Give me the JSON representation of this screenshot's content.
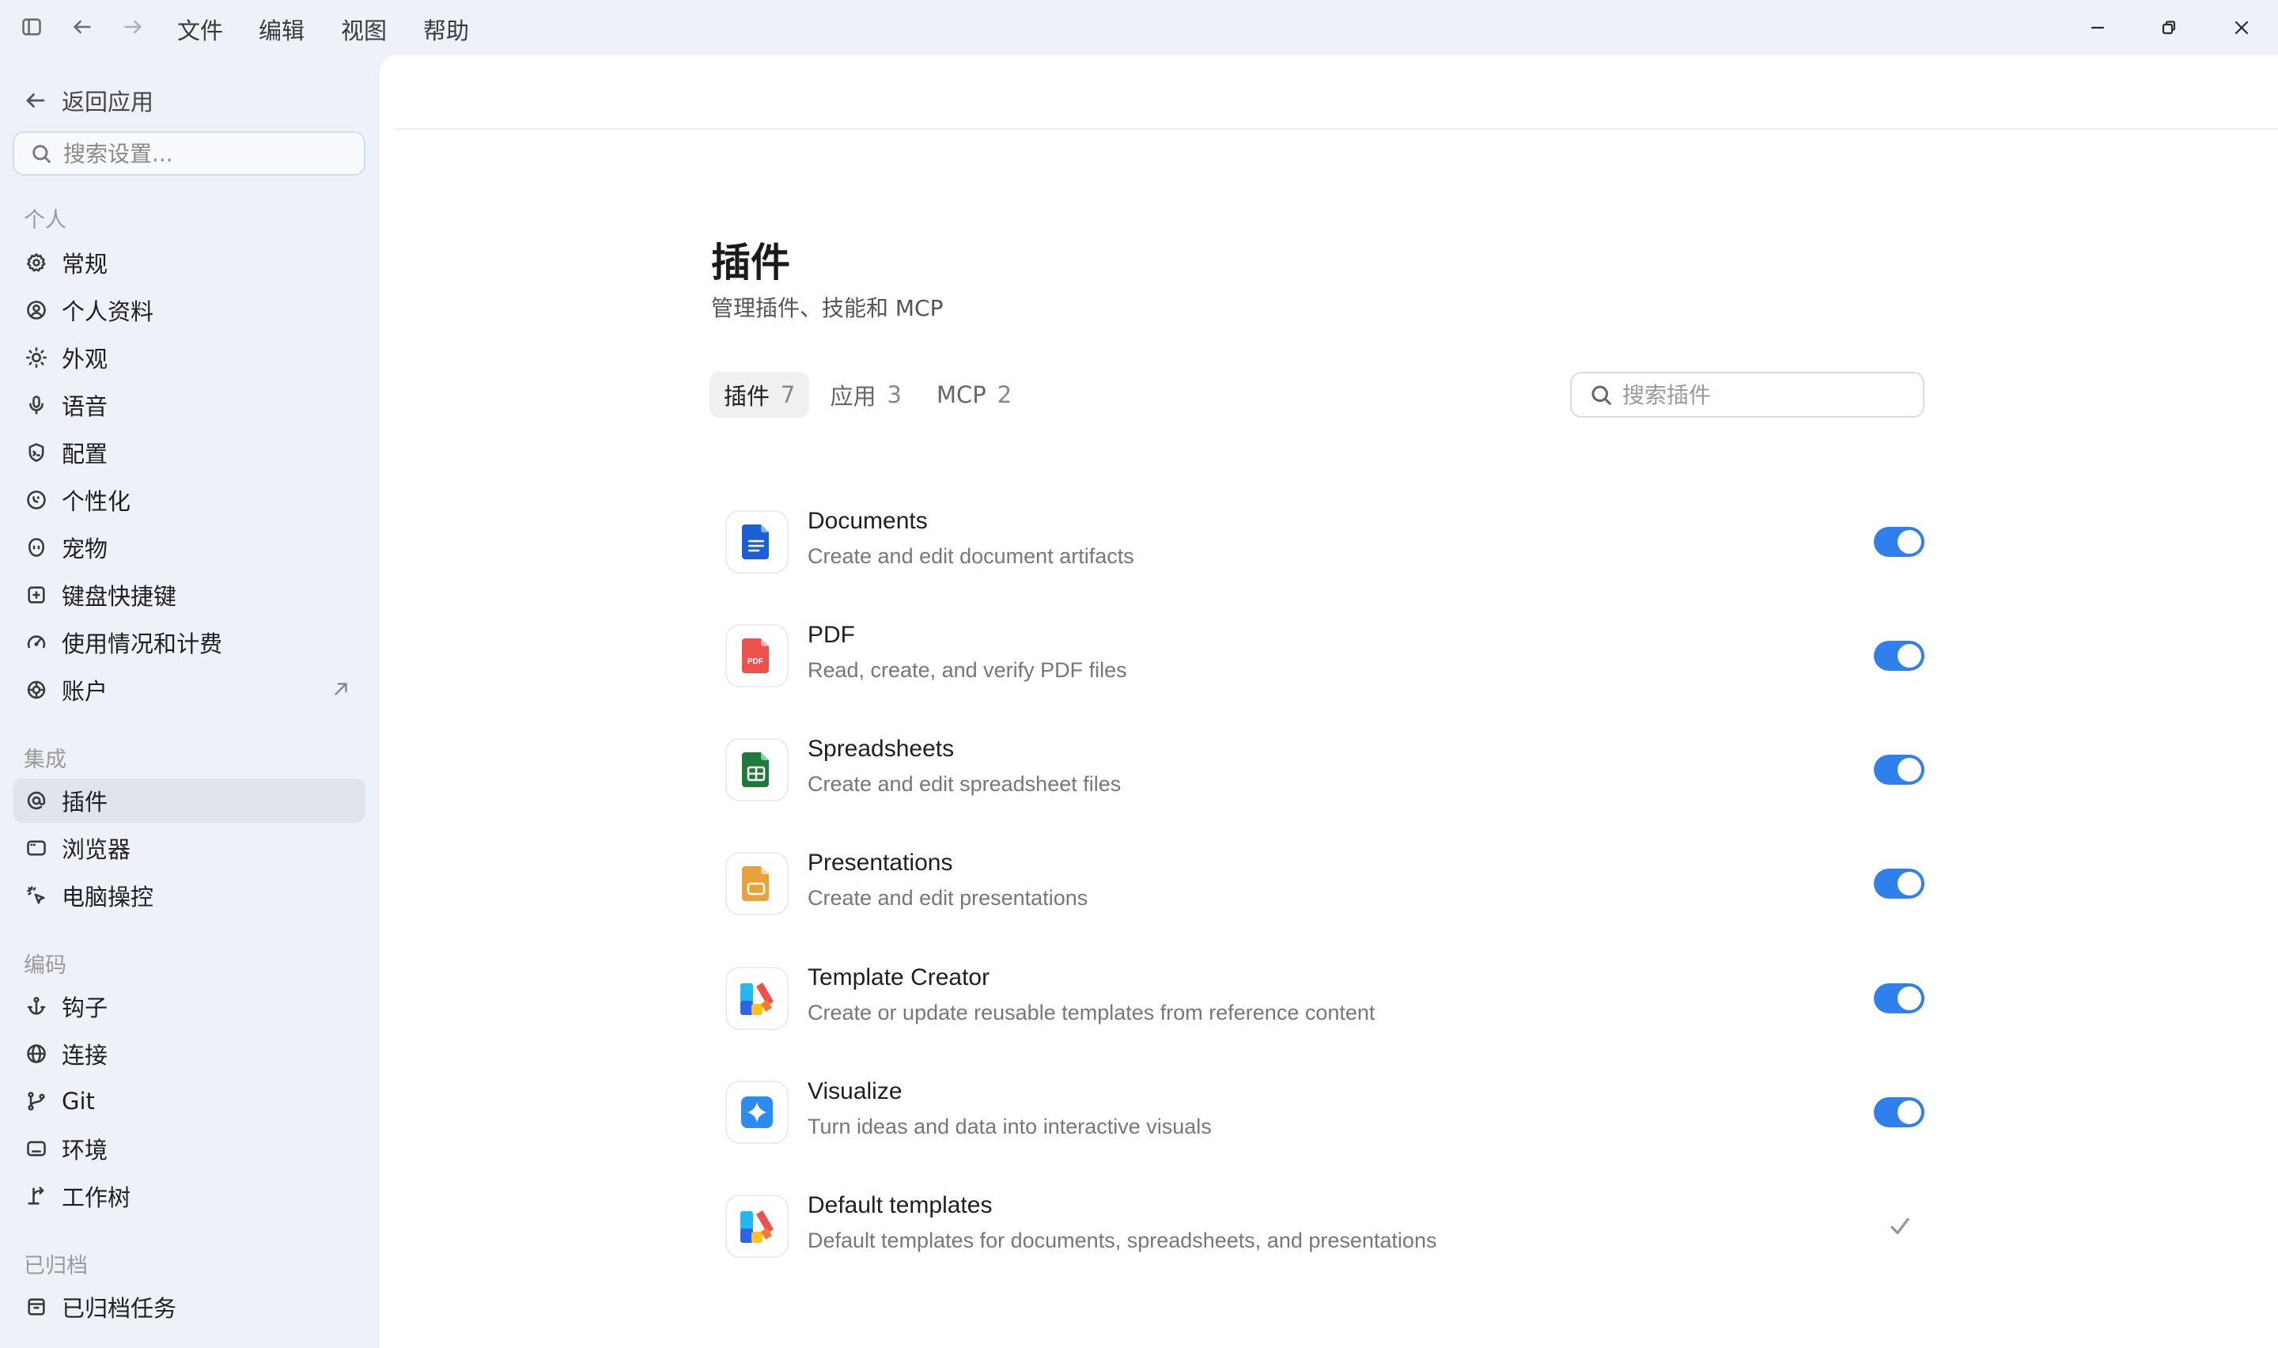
{
  "menu": [
    "文件",
    "编辑",
    "视图",
    "帮助"
  ],
  "sidebar": {
    "back_label": "返回应用",
    "search_placeholder": "搜索设置...",
    "sections": [
      {
        "label": "个人",
        "items": [
          {
            "label": "常规",
            "icon": "gear-icon"
          },
          {
            "label": "个人资料",
            "icon": "user-circle-icon"
          },
          {
            "label": "外观",
            "icon": "sun-icon"
          },
          {
            "label": "语音",
            "icon": "microphone-icon"
          },
          {
            "label": "配置",
            "icon": "shield-icon"
          },
          {
            "label": "个性化",
            "icon": "smile-icon"
          },
          {
            "label": "宠物",
            "icon": "pet-icon"
          },
          {
            "label": "键盘快捷键",
            "icon": "keyboard-icon"
          },
          {
            "label": "使用情况和计费",
            "icon": "gauge-icon"
          },
          {
            "label": "账户",
            "icon": "account-icon"
          }
        ]
      },
      {
        "label": "集成",
        "items": [
          {
            "label": "插件",
            "icon": "at-sign-icon"
          },
          {
            "label": "浏览器",
            "icon": "browser-icon"
          },
          {
            "label": "电脑操控",
            "icon": "cursor-click-icon"
          }
        ]
      },
      {
        "label": "编码",
        "items": [
          {
            "label": "钩子",
            "icon": "anchor-icon"
          },
          {
            "label": "连接",
            "icon": "globe-icon"
          },
          {
            "label": "Git",
            "icon": "git-branch-icon"
          },
          {
            "label": "环境",
            "icon": "terminal-icon"
          },
          {
            "label": "工作树",
            "icon": "worktree-icon"
          }
        ]
      },
      {
        "label": "已归档",
        "items": [
          {
            "label": "已归档任务",
            "icon": "archive-icon"
          }
        ]
      }
    ]
  },
  "main": {
    "title": "插件",
    "subtitle": "管理插件、技能和 MCP",
    "tabs": [
      {
        "label": "插件",
        "count": "7"
      },
      {
        "label": "应用",
        "count": "3"
      },
      {
        "label": "MCP",
        "count": "2"
      }
    ],
    "search_placeholder": "搜索插件",
    "plugins": [
      {
        "name": "Documents",
        "description": "Create and edit document artifacts",
        "icon": "document-icon",
        "enabled": true
      },
      {
        "name": "PDF",
        "description": "Read, create, and verify PDF files",
        "icon": "pdf-icon",
        "icon_text": "PDF",
        "enabled": true
      },
      {
        "name": "Spreadsheets",
        "description": "Create and edit spreadsheet files",
        "icon": "spreadsheet-icon",
        "enabled": true
      },
      {
        "name": "Presentations",
        "description": "Create and edit presentations",
        "icon": "presentation-icon",
        "enabled": true
      },
      {
        "name": "Template Creator",
        "description": "Create or update reusable templates from reference content",
        "icon": "template-creator-icon",
        "enabled": true
      },
      {
        "name": "Visualize",
        "description": "Turn ideas and data into interactive visuals",
        "icon": "sparkle-icon",
        "enabled": true
      },
      {
        "name": "Default templates",
        "description": "Default templates for documents, spreadsheets, and presentations",
        "icon": "default-templates-icon",
        "enabled": null
      }
    ]
  },
  "colors": {
    "accent": "#2f80ed",
    "sidebar_bg": "#eef2f8",
    "active_item_bg": "#e0e5ed"
  }
}
